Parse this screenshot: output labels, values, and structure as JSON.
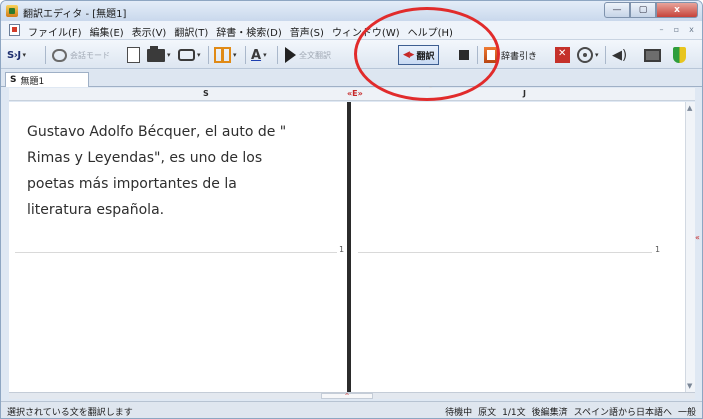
{
  "window": {
    "title": "翻訳エディタ - [無題1]",
    "controls": {
      "minimize": "—",
      "maximize": "▢",
      "close": "x"
    }
  },
  "menu": {
    "items": [
      "ファイル(F)",
      "編集(E)",
      "表示(V)",
      "翻訳(T)",
      "辞書・検索(D)",
      "音声(S)",
      "ウィンドウ(W)",
      "ヘルプ(H)"
    ],
    "mdi_controls": [
      "–",
      "▫",
      "x"
    ]
  },
  "toolbar": {
    "sj_logo": "S›J",
    "dropdown_glyph": "▾",
    "speech_mode_label": "会話モード",
    "translate_label": "翻訳",
    "translate_arrow": "◀▸",
    "dict_label": "辞書引き",
    "font_glyph": "A"
  },
  "tab": {
    "marker": "S",
    "label": "無題1"
  },
  "columns": {
    "source": "S",
    "engine": "«E»",
    "target": "J"
  },
  "editor": {
    "source_lines": [
      "Gustavo Adolfo Bécquer, el auto de \"",
      "Rimas y Leyendas\", es uno de los",
      "poetas más importantes de la",
      "literatura española."
    ],
    "left_sentence_number": "1",
    "right_sentence_number": "1",
    "side_arrow": "«",
    "splitter_arrow": "^"
  },
  "status": {
    "message": "選択されている文を翻訳します",
    "segments": [
      "待機中",
      "原文",
      "1/1文",
      "後編集済",
      "スペイン語から日本語へ",
      "一般"
    ]
  },
  "colors": {
    "annotation": "#e12b2b",
    "accent_red": "#c62828",
    "toolbar_bg": "#dde6f1"
  }
}
